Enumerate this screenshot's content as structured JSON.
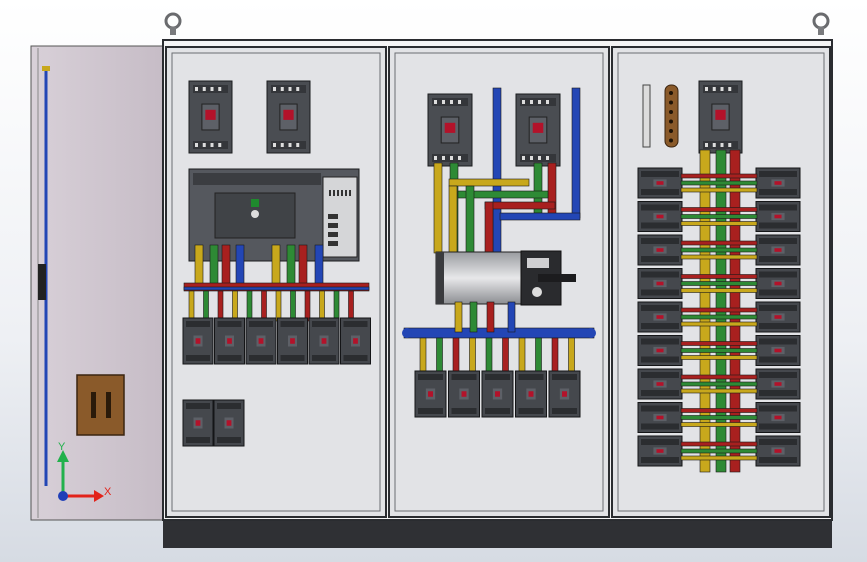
{
  "viewport": {
    "axis_x_label": "X",
    "axis_y_label": "Y"
  },
  "colors": {
    "panel_frame": "#2a2c30",
    "panel_face": "#e2e3e6",
    "door": "#c9bfc9",
    "base": "#2f3034",
    "phase_L1": "#c8a81c",
    "phase_L2": "#2e8a35",
    "phase_L3": "#a8201f",
    "neutral": "#2346b5",
    "terminal_block": "#8a5a2a"
  },
  "icons": {
    "lifting_eye": "lifting-eye-icon",
    "handle": "door-handle-icon",
    "triad": "coordinate-triad-icon"
  }
}
